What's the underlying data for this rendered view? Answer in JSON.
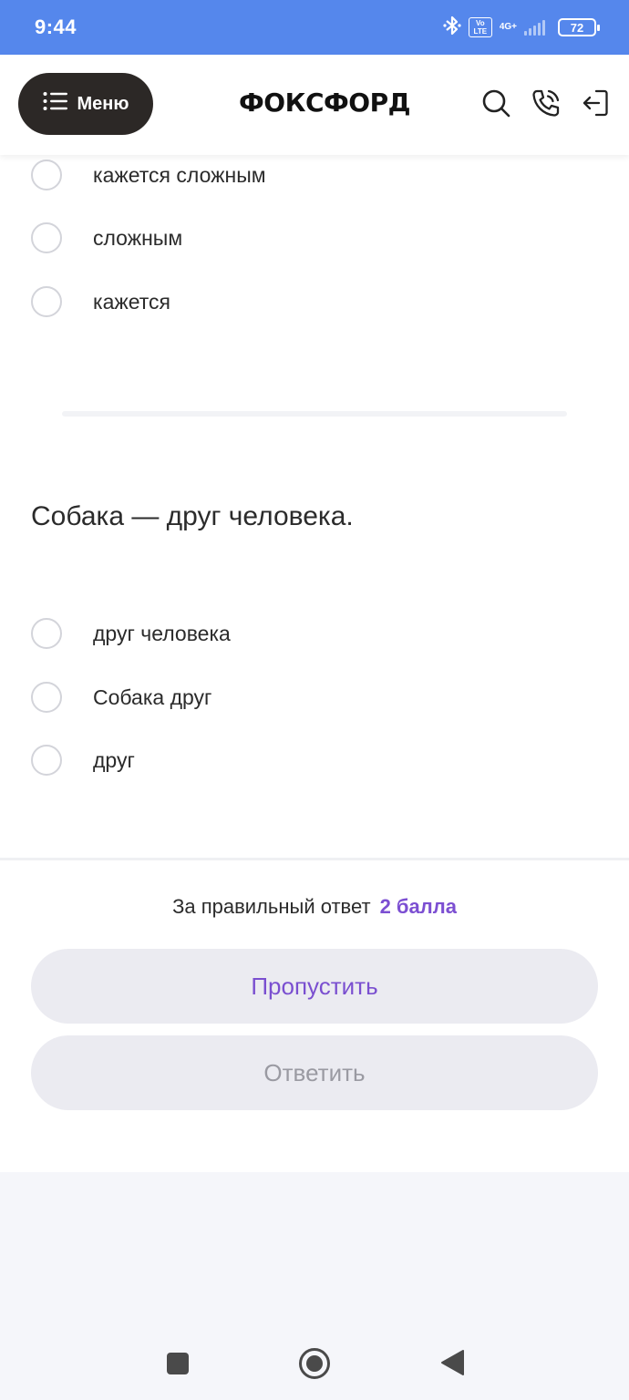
{
  "status_bar": {
    "time": "9:44",
    "volte": "Vo LTE",
    "network": "4G+",
    "battery": "72",
    "icons": [
      "bluetooth-icon",
      "volte-icon",
      "signal-icon",
      "battery-icon"
    ]
  },
  "header": {
    "menu_label": "Меню",
    "logo": "ФОКСФОРД",
    "icons": [
      "search-icon",
      "phone-call-icon",
      "logout-icon"
    ]
  },
  "previous_options": [
    {
      "label": "кажется сложным"
    },
    {
      "label": "сложным"
    },
    {
      "label": "кажется"
    }
  ],
  "question": {
    "text": "Собака — друг человека.",
    "options": [
      {
        "label": "друг человека"
      },
      {
        "label": "Собака друг"
      },
      {
        "label": "друг"
      }
    ]
  },
  "footer": {
    "points_text": "За правильный ответ",
    "points_value": "2 балла",
    "skip_label": "Пропустить",
    "answer_label": "Ответить"
  },
  "colors": {
    "status_bar": "#5587ec",
    "menu_button": "#2c2826",
    "accent_purple": "#7c4fd2",
    "button_bg": "#ebebf1"
  },
  "nav_bar": {
    "icons": [
      "recent-apps-icon",
      "home-icon",
      "back-icon"
    ]
  }
}
